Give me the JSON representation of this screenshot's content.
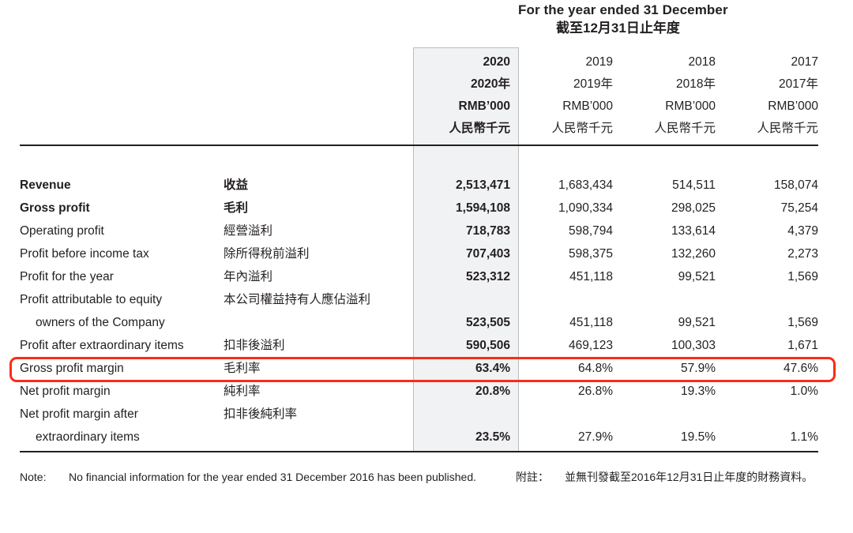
{
  "header": {
    "title_en": "For the year ended 31 December",
    "title_zh": "截至12月31日止年度"
  },
  "columns": [
    {
      "key": "y2020",
      "year": "2020",
      "year_zh": "2020年",
      "unit_en": "RMB’000",
      "unit_zh": "人民幣千元",
      "highlighted": true
    },
    {
      "key": "y2019",
      "year": "2019",
      "year_zh": "2019年",
      "unit_en": "RMB’000",
      "unit_zh": "人民幣千元",
      "highlighted": false
    },
    {
      "key": "y2018",
      "year": "2018",
      "year_zh": "2018年",
      "unit_en": "RMB’000",
      "unit_zh": "人民幣千元",
      "highlighted": false
    },
    {
      "key": "y2017",
      "year": "2017",
      "year_zh": "2017年",
      "unit_en": "RMB’000",
      "unit_zh": "人民幣千元",
      "highlighted": false
    }
  ],
  "rows": [
    {
      "label_en": "Revenue",
      "label_zh": "收益",
      "bold": true,
      "indent": false,
      "y2020": "2,513,471",
      "y2019": "1,683,434",
      "y2018": "514,511",
      "y2017": "158,074"
    },
    {
      "label_en": "Gross profit",
      "label_zh": "毛利",
      "bold": true,
      "indent": false,
      "y2020": "1,594,108",
      "y2019": "1,090,334",
      "y2018": "298,025",
      "y2017": "75,254"
    },
    {
      "label_en": "Operating profit",
      "label_zh": "經營溢利",
      "bold": false,
      "indent": false,
      "y2020": "718,783",
      "y2019": "598,794",
      "y2018": "133,614",
      "y2017": "4,379"
    },
    {
      "label_en": "Profit before income tax",
      "label_zh": "除所得稅前溢利",
      "bold": false,
      "indent": false,
      "y2020": "707,403",
      "y2019": "598,375",
      "y2018": "132,260",
      "y2017": "2,273"
    },
    {
      "label_en": "Profit for the year",
      "label_zh": "年內溢利",
      "bold": false,
      "indent": false,
      "y2020": "523,312",
      "y2019": "451,118",
      "y2018": "99,521",
      "y2017": "1,569"
    },
    {
      "label_en": "Profit attributable to equity",
      "label_zh": "本公司權益持有人應佔溢利",
      "bold": false,
      "indent": false,
      "y2020": "",
      "y2019": "",
      "y2018": "",
      "y2017": ""
    },
    {
      "label_en": "owners of the Company",
      "label_zh": "",
      "bold": false,
      "indent": true,
      "y2020": "523,505",
      "y2019": "451,118",
      "y2018": "99,521",
      "y2017": "1,569"
    },
    {
      "label_en": "Profit after extraordinary items",
      "label_zh": "扣非後溢利",
      "bold": false,
      "indent": false,
      "y2020": "590,506",
      "y2019": "469,123",
      "y2018": "100,303",
      "y2017": "1,671"
    },
    {
      "label_en": "Gross profit margin",
      "label_zh": "毛利率",
      "bold": false,
      "indent": false,
      "y2020": "63.4%",
      "y2019": "64.8%",
      "y2018": "57.9%",
      "y2017": "47.6%"
    },
    {
      "label_en": "Net profit margin",
      "label_zh": "純利率",
      "bold": false,
      "indent": false,
      "y2020": "20.8%",
      "y2019": "26.8%",
      "y2018": "19.3%",
      "y2017": "1.0%"
    },
    {
      "label_en": "Net profit margin after",
      "label_zh": "扣非後純利率",
      "bold": false,
      "indent": false,
      "y2020": "",
      "y2019": "",
      "y2018": "",
      "y2017": ""
    },
    {
      "label_en": "extraordinary items",
      "label_zh": "",
      "bold": false,
      "indent": true,
      "y2020": "23.5%",
      "y2019": "27.9%",
      "y2018": "19.5%",
      "y2017": "1.1%"
    }
  ],
  "notes": {
    "tag_en": "Note:",
    "text_en": "No financial information for the year ended 31 December 2016 has been published.",
    "tag_zh": "附註：",
    "text_zh": "並無刊發截至2016年12月31日止年度的財務資料。"
  },
  "emphasis": {
    "row_label": "Gross profit margin",
    "color": "#fb2c16"
  }
}
